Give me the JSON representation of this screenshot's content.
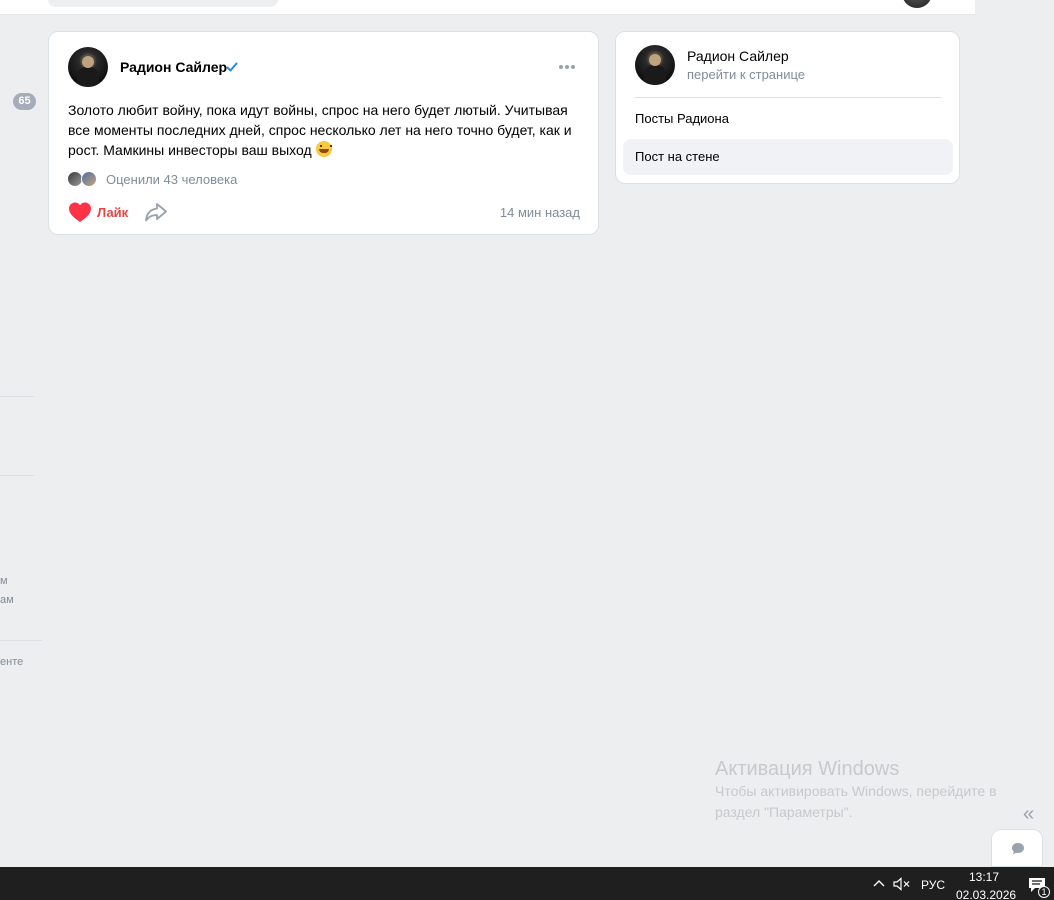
{
  "topbar": {
    "nav_fragment": ""
  },
  "left_nav": {
    "badge_count": "65",
    "fragments": [
      "м",
      "ам",
      "енте"
    ]
  },
  "post": {
    "author": "Радион Сайлер",
    "verified": true,
    "text": "Золото любит войну, пока идут войны, спрос на него будет лютый. Учитывая все моменты последних дней, спрос несколько лет на него точно будет, как и рост. Мамкины инвесторы ваш выход",
    "emoji": "grinning-face",
    "rated_text": "Оценили 43 человека",
    "like_label": "Лайк",
    "time": "14 мин назад",
    "like_color": "#e64646"
  },
  "side_panel": {
    "name": "Радион Сайлер",
    "link": "перейти к странице",
    "items": [
      {
        "label": "Посты Радиона",
        "active": false
      },
      {
        "label": "Пост на стене",
        "active": true
      }
    ]
  },
  "watermark": {
    "title": "Активация Windows",
    "subtitle": "Чтобы активировать Windows, перейдите в раздел \"Параметры\"."
  },
  "taskbar": {
    "language": "РУС",
    "time": "13:17",
    "date": "02.03.2026",
    "notification_count": "1"
  },
  "colors": {
    "accent": "#2688eb",
    "background": "#edeef0",
    "secondary_text": "#818c99"
  }
}
